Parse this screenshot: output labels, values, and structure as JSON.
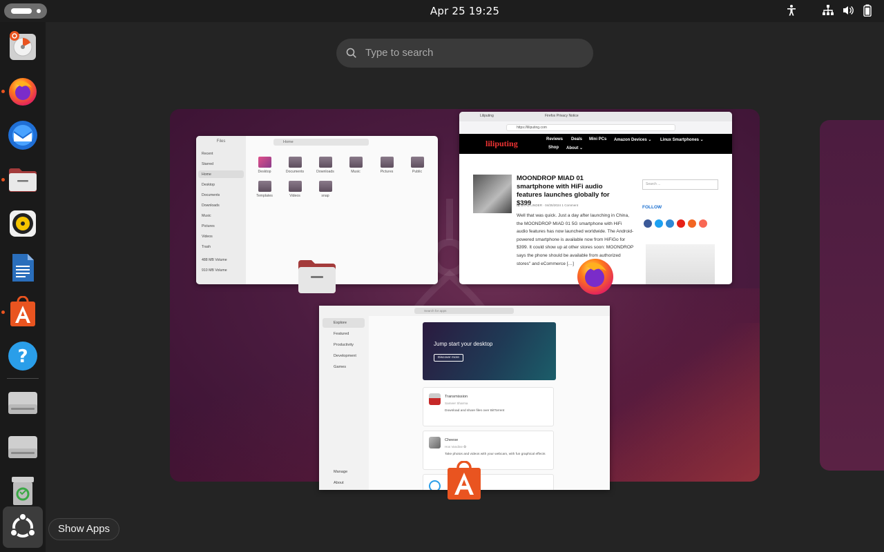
{
  "topbar": {
    "clock": "Apr 25  19:25"
  },
  "search": {
    "placeholder": "Type to search"
  },
  "dock": {
    "tooltip": "Show Apps",
    "items": [
      "disk-usage",
      "firefox",
      "thunderbird",
      "files",
      "rhythmbox",
      "libreoffice-writer",
      "app-center",
      "help",
      "volume-1",
      "volume-2",
      "trash"
    ]
  },
  "files_window": {
    "title": "Files",
    "path": "Home",
    "sidebar": [
      "Recent",
      "Starred",
      "Home",
      "Desktop",
      "Documents",
      "Downloads",
      "Music",
      "Pictures",
      "Videos",
      "Trash",
      "488 MB Volume",
      "910 MB Volume"
    ],
    "folders": [
      "Desktop",
      "Documents",
      "Downloads",
      "Music",
      "Pictures",
      "Public",
      "Templates",
      "Videos",
      "snap"
    ]
  },
  "firefox_window": {
    "tabs": [
      "Liliputing",
      "Firefox Privacy Notice"
    ],
    "url": "https://liliputing.com",
    "logo": "liliputing",
    "nav": [
      "Reviews",
      "Deals",
      "Mini PCs",
      "Amazon Devices ⌄",
      "Linux Smartphones ⌄",
      "Shop",
      "About ⌄"
    ],
    "headline": "MOONDROP MIAD 01 smartphone with HiFi audio features launches globally for $399",
    "byline": "by BRAD LINDER · 04/25/2024 1 Comment",
    "body": "Well that was quick. Just a day after launching in China, the MOONDROP MIAD 01 5G smartphone with HiFi audio features has now launched worldwide. The Android-powered smartphone is available now from HiFiGo for $399. It could show up at other stores soon: MOONDROP says the phone should be available from authorized stores\" and eCommerce […]",
    "search_placeholder": "Search ...",
    "follow": "FOLLOW"
  },
  "appcenter_window": {
    "search_placeholder": "Search for apps",
    "sidebar": [
      "Explore",
      "Featured",
      "Productivity",
      "Development",
      "Games"
    ],
    "sidebar_bottom": [
      "Manage",
      "About"
    ],
    "banner_title": "Jump start your desktop",
    "banner_button": "Discover more",
    "cards": [
      {
        "title": "Transmission",
        "subtitle": "Sameer Sharma",
        "desc": "Download and share files over BitTorrent"
      },
      {
        "title": "Cheese",
        "subtitle": "Hos Vandine ✪",
        "desc": "Take photos and videos with your webcam, with fun graphical effects"
      }
    ]
  }
}
